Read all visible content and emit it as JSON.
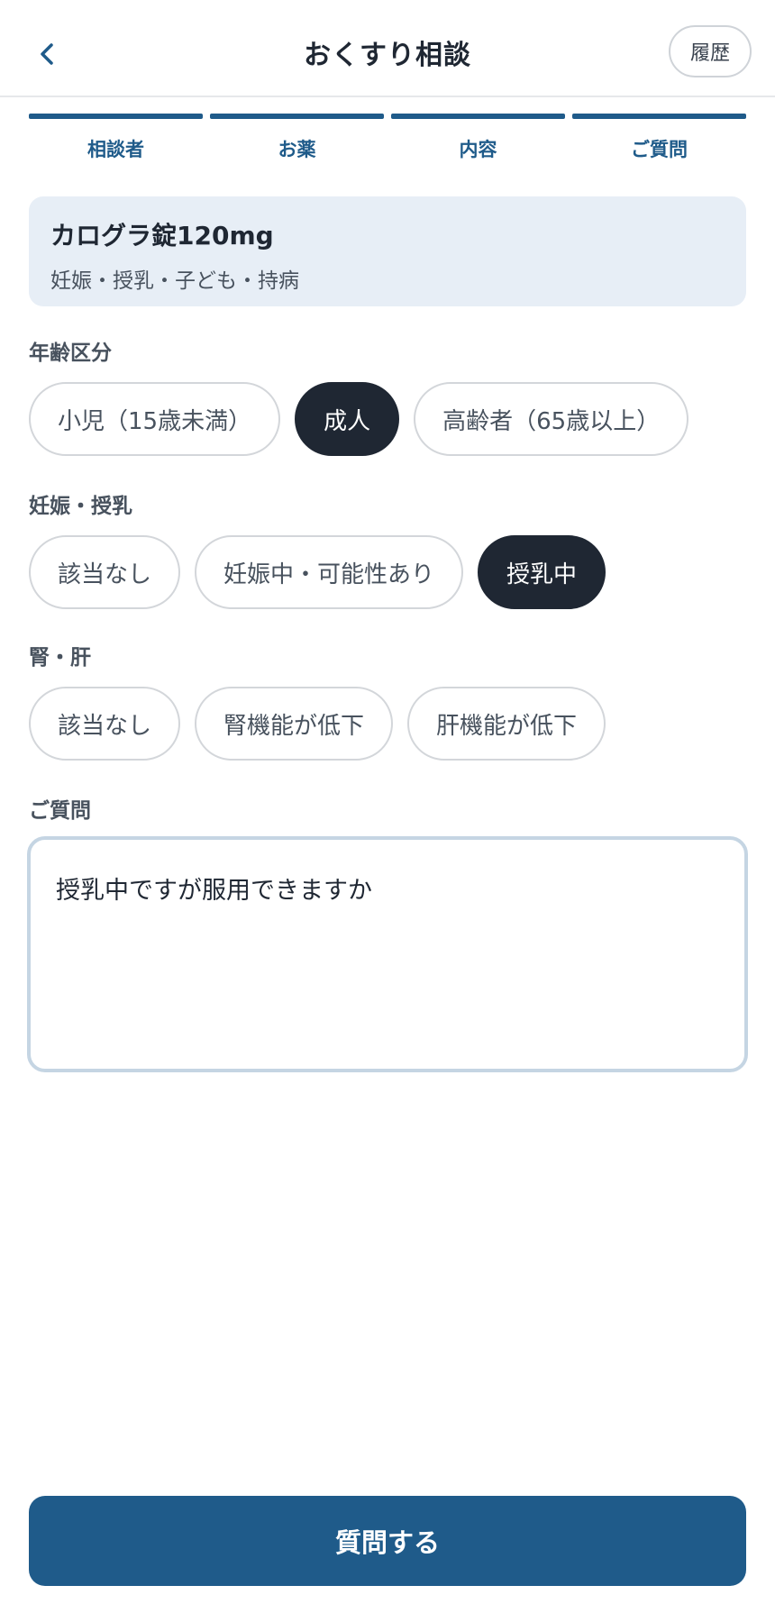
{
  "header": {
    "title": "おくすり相談",
    "history_label": "履歴",
    "back_icon": "chevron-left-icon"
  },
  "steps": [
    {
      "label": "相談者"
    },
    {
      "label": "お薬"
    },
    {
      "label": "内容"
    },
    {
      "label": "ご質問"
    }
  ],
  "drug": {
    "name": "カログラ錠120mg",
    "tags": "妊娠・授乳・子ども・持病"
  },
  "age": {
    "label": "年齢区分",
    "options": [
      "小児（15歳未満）",
      "成人",
      "高齢者（65歳以上）"
    ],
    "selected": "成人"
  },
  "pregnancy": {
    "label": "妊娠・授乳",
    "options": [
      "該当なし",
      "妊娠中・可能性あり",
      "授乳中"
    ],
    "selected": "授乳中"
  },
  "organ": {
    "label": "腎・肝",
    "options": [
      "該当なし",
      "腎機能が低下",
      "肝機能が低下"
    ],
    "selected": ""
  },
  "question": {
    "label": "ご質問",
    "value": "授乳中ですが服用できますか"
  },
  "submit_label": "質問する",
  "colors": {
    "accent": "#1f5b8a",
    "selected_chip": "#1f2733",
    "card_bg": "#e7eef6"
  }
}
